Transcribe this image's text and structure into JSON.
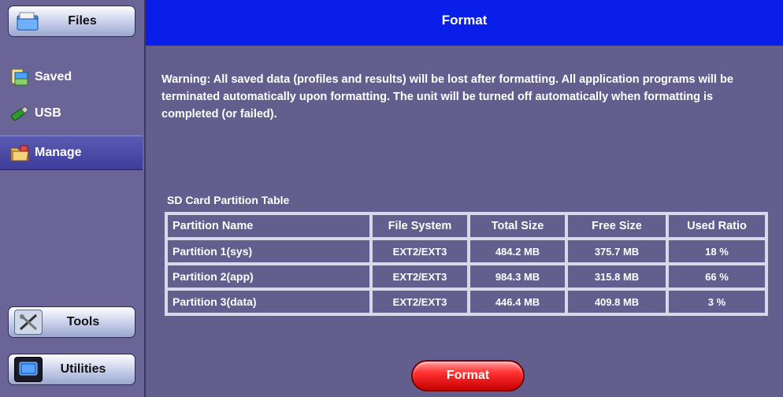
{
  "sidebar": {
    "files_label": "Files",
    "items": [
      {
        "label": "Saved",
        "icon": "folder-icon"
      },
      {
        "label": "USB",
        "icon": "usb-icon"
      },
      {
        "label": "Manage",
        "icon": "manage-folder-icon",
        "selected": true
      }
    ],
    "tools_label": "Tools",
    "utilities_label": "Utilities"
  },
  "header": {
    "title": "Format"
  },
  "main": {
    "warning": "Warning: All saved data (profiles and results) will be lost after formatting. All application programs will be terminated automatically upon formatting. The unit will be turned off automatically when formatting is completed (or failed).",
    "table_title": "SD Card Partition Table",
    "columns": [
      "Partition Name",
      "File System",
      "Total Size",
      "Free Size",
      "Used Ratio"
    ],
    "rows": [
      [
        "Partition 1(sys)",
        "EXT2/EXT3",
        "484.2 MB",
        "375.7 MB",
        "18 %"
      ],
      [
        "Partition 2(app)",
        "EXT2/EXT3",
        "984.3 MB",
        "315.8 MB",
        "66 %"
      ],
      [
        "Partition 3(data)",
        "EXT2/EXT3",
        "446.4 MB",
        "409.8 MB",
        "3 %"
      ]
    ],
    "format_button": "Format"
  },
  "colors": {
    "title_bar": "#0a1eea",
    "content_bg": "#625e8e",
    "sidebar_bg": "#6a6596",
    "selected_item": "#4747a6",
    "format_button": "#ff3030"
  }
}
